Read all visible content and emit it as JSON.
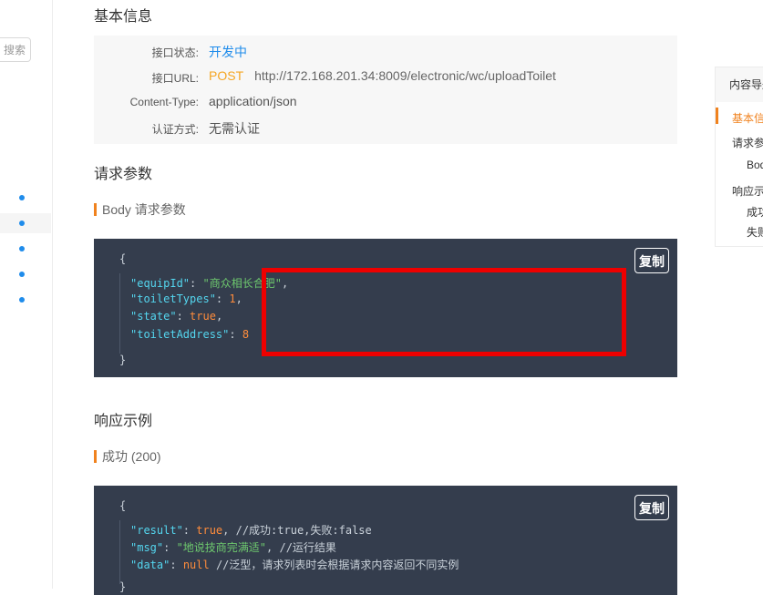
{
  "left_sidebar": {
    "search_label": "搜索"
  },
  "basic_info": {
    "title": "基本信息",
    "rows": [
      {
        "label": "接口状态:",
        "value": "开发中"
      },
      {
        "label": "接口URL:",
        "method": "POST",
        "url": "http://172.168.201.34:8009/electronic/wc/uploadToilet"
      },
      {
        "label": "Content-Type:",
        "value": "application/json"
      },
      {
        "label": "认证方式:",
        "value": "无需认证"
      }
    ]
  },
  "request_params": {
    "title": "请求参数",
    "body_label": "Body 请求参数",
    "copy_label": "复制",
    "code": {
      "open": "{",
      "close": "}",
      "lines": [
        {
          "key": "\"equipId\"",
          "value": "\"商众相长合肥\"",
          "punct": ","
        },
        {
          "key": "\"toiletTypes\"",
          "value": "1",
          "punct": ","
        },
        {
          "key": "\"state\"",
          "value": "true",
          "punct": ","
        },
        {
          "key": "\"toiletAddress\"",
          "value": "8",
          "punct": ""
        }
      ]
    }
  },
  "response_example": {
    "title": "响应示例",
    "success_label": "成功 (200)",
    "copy_label": "复制",
    "code": {
      "open": "{",
      "close": "}",
      "lines": [
        {
          "key": "\"result\"",
          "value": "true",
          "comment": ", //成功:true,失败:false"
        },
        {
          "key": "\"msg\"",
          "value": "\"地说技商完满适\"",
          "comment": ", //运行结果"
        },
        {
          "key": "\"data\"",
          "value": "null",
          "comment": " //泛型，请求列表时会根据请求内容返回不同实例"
        }
      ]
    }
  },
  "toc": {
    "head": "内容导航",
    "items": [
      {
        "label": "基本信息",
        "active": true
      },
      {
        "label": "请求参数",
        "active": false
      },
      {
        "label": "Body 请求参数",
        "active": false
      },
      {
        "label": "响应示例",
        "active": false
      },
      {
        "label": "成功",
        "active": false
      },
      {
        "label": "失败",
        "active": false
      }
    ]
  },
  "colors": {
    "accent": "#f0821e",
    "link": "#1f8ceb",
    "code_bg": "#343d4d",
    "highlight_box": "#ee0000"
  }
}
